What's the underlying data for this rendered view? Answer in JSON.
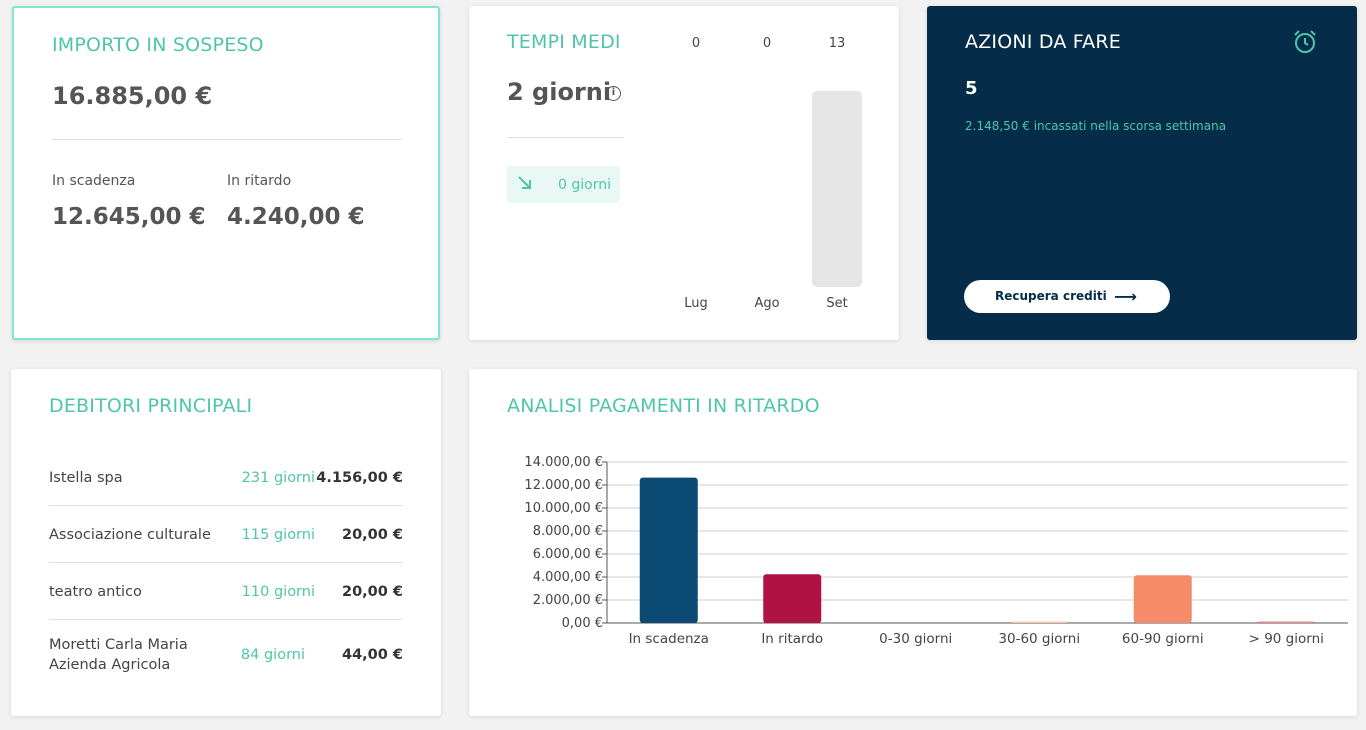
{
  "outstanding": {
    "title": "IMPORTO IN SOSPESO",
    "total": "16.885,00 €",
    "due_label": "In scadenza",
    "due_value": "12.645,00 €",
    "late_label": "In ritardo",
    "late_value": "4.240,00 €"
  },
  "avg_times": {
    "title": "TEMPI MEDI",
    "value": "2 giorni",
    "info_icon": "info-icon",
    "trend_icon": "arrow-down-right-icon",
    "trend_text": "0 giorni",
    "mini_chart": {
      "months": [
        "Lug",
        "Ago",
        "Set"
      ],
      "values": [
        0,
        0,
        13
      ],
      "value_labels": [
        "0",
        "0",
        "13"
      ],
      "bar_color": "#e5e5e5"
    }
  },
  "actions": {
    "title": "AZIONI DA FARE",
    "icon": "alarm-clock-icon",
    "count": "5",
    "subtitle": "2.148,50 € incassati nella scorsa settimana",
    "button_label": "Recupera crediti",
    "button_icon": "arrow-right-icon",
    "bg_color": "#052d4a"
  },
  "debtors": {
    "title": "DEBITORI PRINCIPALI",
    "rows": [
      {
        "name": "Istella spa",
        "days": "231 giorni",
        "amount": "4.156,00 €"
      },
      {
        "name": "Associazione culturale",
        "days": "115 giorni",
        "amount": "20,00 €"
      },
      {
        "name": "teatro antico",
        "days": "110 giorni",
        "amount": "20,00 €"
      },
      {
        "name": "Moretti Carla Maria\nAzienda Agricola",
        "days": "84 giorni",
        "amount": "44,00 €"
      }
    ]
  },
  "analysis": {
    "title": "ANALISI PAGAMENTI IN RITARDO"
  },
  "chart_data": [
    {
      "type": "bar",
      "categories": [
        "In scadenza",
        "In ritardo",
        "0-30 giorni",
        "30-60 giorni",
        "60-90 giorni",
        "> 90 giorni"
      ],
      "values": [
        12645,
        4240,
        0,
        20,
        4156,
        44
      ],
      "colors": [
        "#0b4a72",
        "#b01244",
        "#cccccc",
        "#f6c9a8",
        "#f58b68",
        "#e08a8a"
      ],
      "ylim": [
        0,
        14000
      ],
      "ytick_labels": [
        "0,00 €",
        "2.000,00 €",
        "4.000,00 €",
        "6.000,00 €",
        "8.000,00 €",
        "10.000,00 €",
        "12.000,00 €",
        "14.000,00 €"
      ],
      "grid": true,
      "title": "ANALISI PAGAMENTI IN RITARDO"
    }
  ],
  "colors": {
    "accent": "#4fc6a8",
    "highlight_border": "#7fe6d0"
  }
}
